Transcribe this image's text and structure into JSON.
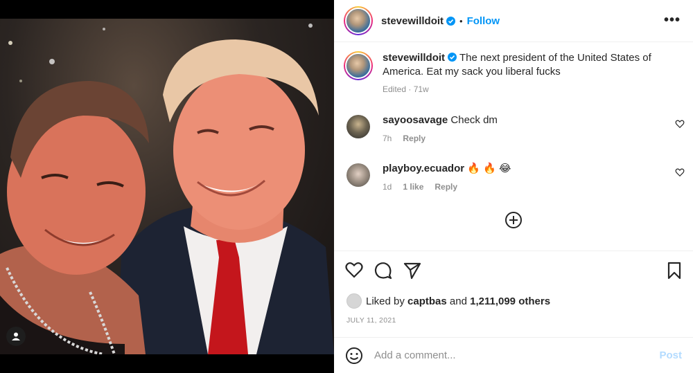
{
  "post": {
    "author": "stevewilldoit",
    "separator": "•",
    "follow_label": "Follow",
    "more_label": "•••",
    "caption": "The next president of the United States of America. Eat my sack you liberal fucks",
    "caption_meta": "Edited · 71w"
  },
  "comments": [
    {
      "user": "sayoosavage",
      "text": "Check dm",
      "time": "7h",
      "likes": "",
      "reply": "Reply"
    },
    {
      "user": "playboy.ecuador",
      "text": "🔥 🔥 😂",
      "time": "1d",
      "likes": "1 like",
      "reply": "Reply"
    }
  ],
  "likes": {
    "prefix": "Liked by",
    "user": "captbas",
    "middle": "and",
    "count": "1,211,099 others"
  },
  "date": "JULY 11, 2021",
  "add_comment": {
    "placeholder": "Add a comment...",
    "post_label": "Post"
  },
  "colors": {
    "accent": "#0095f6",
    "post_disabled": "#b3dbff",
    "muted": "#8e8e8e",
    "verified": "#0095f6"
  }
}
